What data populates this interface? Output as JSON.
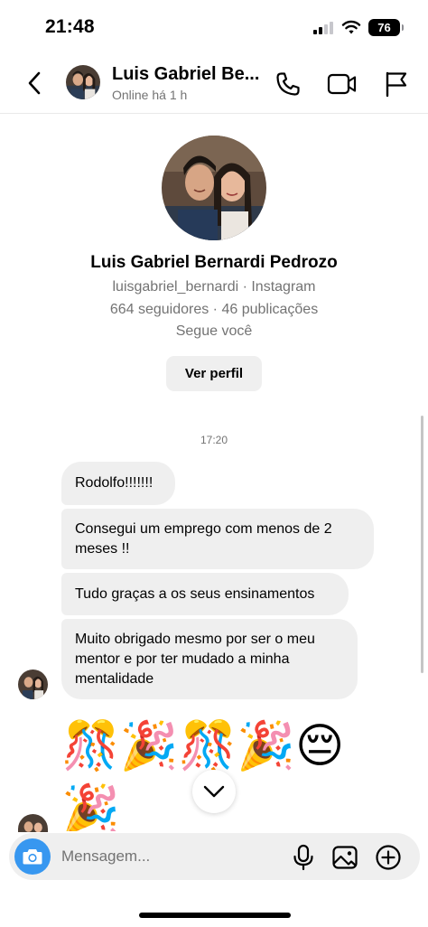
{
  "status_bar": {
    "time": "21:48",
    "battery": "76"
  },
  "header": {
    "name": "Luis Gabriel Be...",
    "status": "Online há 1 h"
  },
  "profile": {
    "full_name": "Luis Gabriel Bernardi Pedrozo",
    "handle_line": "luisgabriel_bernardi · Instagram",
    "stats_line": "664 seguidores · 46 publicações",
    "follow_line": "Segue você",
    "view_profile_label": "Ver perfil"
  },
  "conversation": {
    "timestamp": "17:20",
    "messages": [
      {
        "text": "Rodolfo!!!!!!!"
      },
      {
        "text": "Consegui um emprego com menos de 2 meses !!"
      },
      {
        "text": "Tudo graças a os seus ensinamentos"
      },
      {
        "text": "Muito obrigado mesmo por ser o meu mentor e por ter mudado a minha mentalidade"
      }
    ],
    "emoji_line_1": "🎊🎉🎊🎉😔",
    "emoji_line_2": "🎉"
  },
  "composer": {
    "placeholder": "Mensagem..."
  },
  "icons": {
    "back": "chevron-left-icon",
    "call": "phone-icon",
    "video": "video-camera-icon",
    "report": "flag-icon",
    "camera": "camera-icon",
    "mic": "microphone-icon",
    "gallery": "image-icon",
    "add": "plus-circle-icon",
    "scroll_down": "chevron-down-icon"
  },
  "colors": {
    "accent": "#3797f0",
    "bubble": "#efefef",
    "secondary_text": "#737373"
  }
}
